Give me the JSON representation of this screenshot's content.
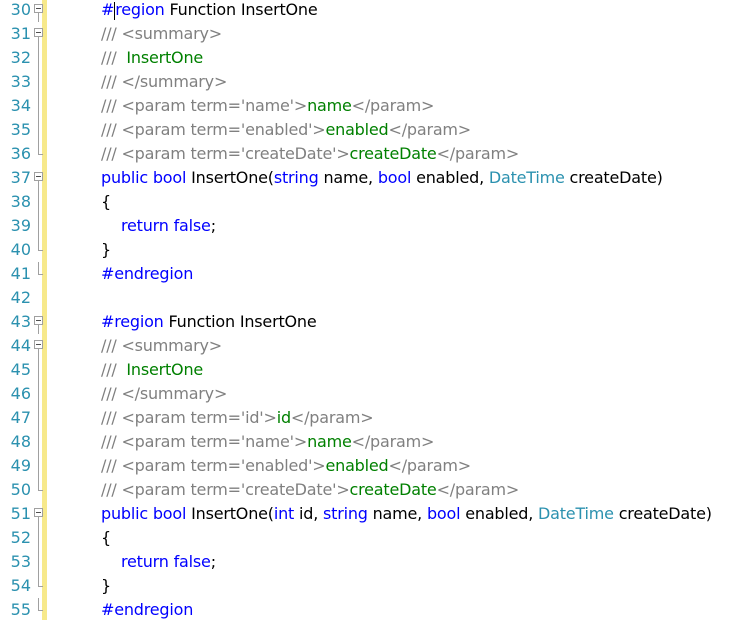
{
  "editor": {
    "lines": [
      {
        "n": "30",
        "fold": "start",
        "parts": [
          [
            "kw",
            "#"
          ],
          [
            "caret",
            ""
          ],
          [
            "kw",
            "region"
          ],
          [
            "tx",
            " Function InsertOne"
          ]
        ]
      },
      {
        "n": "31",
        "fold": "start",
        "parts": [
          [
            "cm",
            "/// <summary>"
          ]
        ]
      },
      {
        "n": "32",
        "fold": "line",
        "parts": [
          [
            "cm",
            "/// "
          ],
          [
            "gr",
            " InsertOne"
          ]
        ]
      },
      {
        "n": "33",
        "fold": "line",
        "parts": [
          [
            "cm",
            "/// </summary>"
          ]
        ]
      },
      {
        "n": "34",
        "fold": "line",
        "parts": [
          [
            "cm",
            "/// <param term='name'>"
          ],
          [
            "gr",
            "name"
          ],
          [
            "cm",
            "</param>"
          ]
        ]
      },
      {
        "n": "35",
        "fold": "line",
        "parts": [
          [
            "cm",
            "/// <param term='enabled'>"
          ],
          [
            "gr",
            "enabled"
          ],
          [
            "cm",
            "</param>"
          ]
        ]
      },
      {
        "n": "36",
        "fold": "end",
        "parts": [
          [
            "cm",
            "/// <param term='createDate'>"
          ],
          [
            "gr",
            "createDate"
          ],
          [
            "cm",
            "</param>"
          ]
        ]
      },
      {
        "n": "37",
        "fold": "start",
        "parts": [
          [
            "kw",
            "public"
          ],
          [
            "tx",
            " "
          ],
          [
            "kw",
            "bool"
          ],
          [
            "tx",
            " InsertOne("
          ],
          [
            "kw",
            "string"
          ],
          [
            "tx",
            " name, "
          ],
          [
            "kw",
            "bool"
          ],
          [
            "tx",
            " enabled, "
          ],
          [
            "tp",
            "DateTime"
          ],
          [
            "tx",
            " createDate)"
          ]
        ]
      },
      {
        "n": "38",
        "fold": "line",
        "parts": [
          [
            "tx",
            "{"
          ]
        ]
      },
      {
        "n": "39",
        "fold": "line",
        "indent": 1,
        "parts": [
          [
            "kw",
            "return"
          ],
          [
            "tx",
            " "
          ],
          [
            "kw",
            "false"
          ],
          [
            "tx",
            ";"
          ]
        ]
      },
      {
        "n": "40",
        "fold": "end",
        "parts": [
          [
            "tx",
            "}"
          ]
        ]
      },
      {
        "n": "41",
        "fold": "end",
        "parts": [
          [
            "kw",
            "#endregion"
          ]
        ]
      },
      {
        "n": "42",
        "fold": "none",
        "parts": []
      },
      {
        "n": "43",
        "fold": "start",
        "parts": [
          [
            "kw",
            "#region"
          ],
          [
            "tx",
            " Function InsertOne"
          ]
        ]
      },
      {
        "n": "44",
        "fold": "start",
        "parts": [
          [
            "cm",
            "/// <summary>"
          ]
        ]
      },
      {
        "n": "45",
        "fold": "line",
        "parts": [
          [
            "cm",
            "/// "
          ],
          [
            "gr",
            " InsertOne"
          ]
        ]
      },
      {
        "n": "46",
        "fold": "line",
        "parts": [
          [
            "cm",
            "/// </summary>"
          ]
        ]
      },
      {
        "n": "47",
        "fold": "line",
        "parts": [
          [
            "cm",
            "/// <param term='id'>"
          ],
          [
            "gr",
            "id"
          ],
          [
            "cm",
            "</param>"
          ]
        ]
      },
      {
        "n": "48",
        "fold": "line",
        "parts": [
          [
            "cm",
            "/// <param term='name'>"
          ],
          [
            "gr",
            "name"
          ],
          [
            "cm",
            "</param>"
          ]
        ]
      },
      {
        "n": "49",
        "fold": "line",
        "parts": [
          [
            "cm",
            "/// <param term='enabled'>"
          ],
          [
            "gr",
            "enabled"
          ],
          [
            "cm",
            "</param>"
          ]
        ]
      },
      {
        "n": "50",
        "fold": "end",
        "parts": [
          [
            "cm",
            "/// <param term='createDate'>"
          ],
          [
            "gr",
            "createDate"
          ],
          [
            "cm",
            "</param>"
          ]
        ]
      },
      {
        "n": "51",
        "fold": "start",
        "parts": [
          [
            "kw",
            "public"
          ],
          [
            "tx",
            " "
          ],
          [
            "kw",
            "bool"
          ],
          [
            "tx",
            " InsertOne("
          ],
          [
            "kw",
            "int"
          ],
          [
            "tx",
            " id, "
          ],
          [
            "kw",
            "string"
          ],
          [
            "tx",
            " name, "
          ],
          [
            "kw",
            "bool"
          ],
          [
            "tx",
            " enabled, "
          ],
          [
            "tp",
            "DateTime"
          ],
          [
            "tx",
            " createDate)"
          ]
        ]
      },
      {
        "n": "52",
        "fold": "line",
        "parts": [
          [
            "tx",
            "{"
          ]
        ]
      },
      {
        "n": "53",
        "fold": "line",
        "indent": 1,
        "parts": [
          [
            "kw",
            "return"
          ],
          [
            "tx",
            " "
          ],
          [
            "kw",
            "false"
          ],
          [
            "tx",
            ";"
          ]
        ]
      },
      {
        "n": "54",
        "fold": "end",
        "parts": [
          [
            "tx",
            "}"
          ]
        ]
      },
      {
        "n": "55",
        "fold": "end",
        "parts": [
          [
            "kw",
            "#endregion"
          ]
        ]
      }
    ]
  }
}
